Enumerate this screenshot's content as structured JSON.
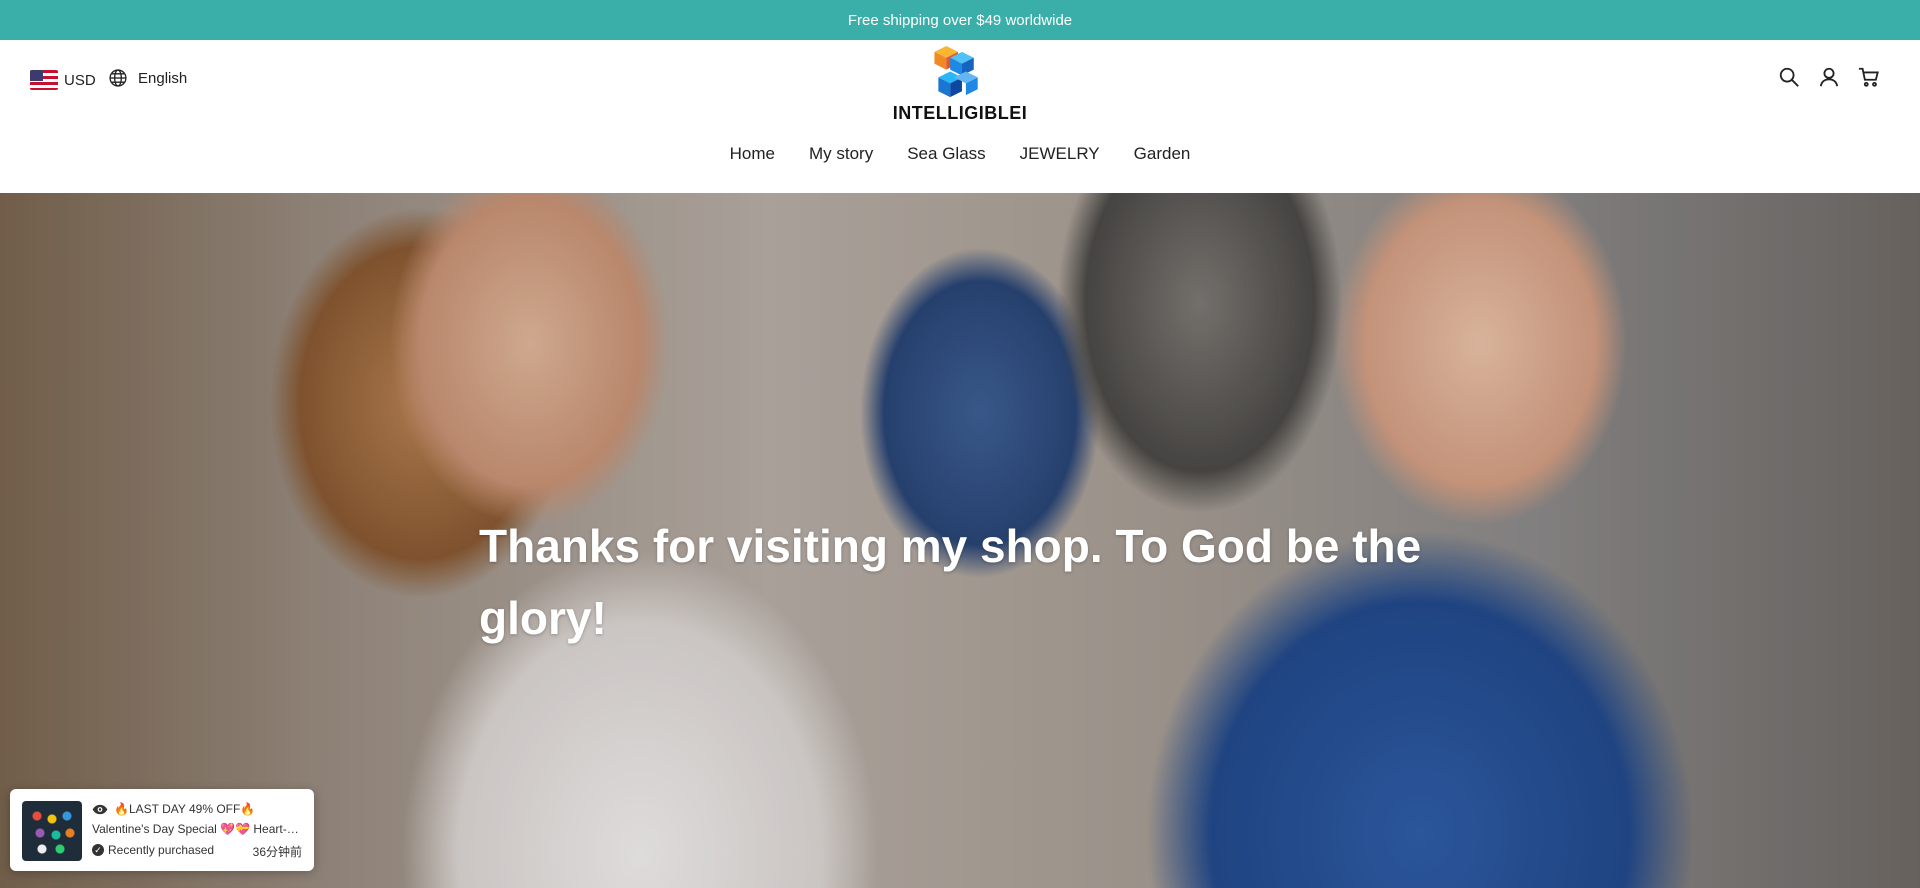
{
  "announcement": {
    "text": "Free shipping over $49 worldwide"
  },
  "header": {
    "currency": "USD",
    "language": "English",
    "logo_text": "INTELLIGIBLEI",
    "icons": [
      "search-icon",
      "account-icon",
      "cart-icon"
    ]
  },
  "nav": {
    "items": [
      {
        "label": "Home"
      },
      {
        "label": "My story"
      },
      {
        "label": "Sea Glass"
      },
      {
        "label": "JEWELRY"
      },
      {
        "label": "Garden"
      }
    ]
  },
  "hero": {
    "heading": "Thanks for visiting my shop. To God be the glory!"
  },
  "purchase_popup": {
    "badge_text": "🔥LAST DAY 49% OFF🔥",
    "product": "Valentine's Day Special 💖💝 Heart-Shaped Sea Glass Jewelry",
    "status": "Recently purchased",
    "time": "36分钟前"
  },
  "colors": {
    "announcement_bg": "#3aafa9",
    "announcement_text": "#ffffff",
    "hero_text": "#ffffff"
  }
}
